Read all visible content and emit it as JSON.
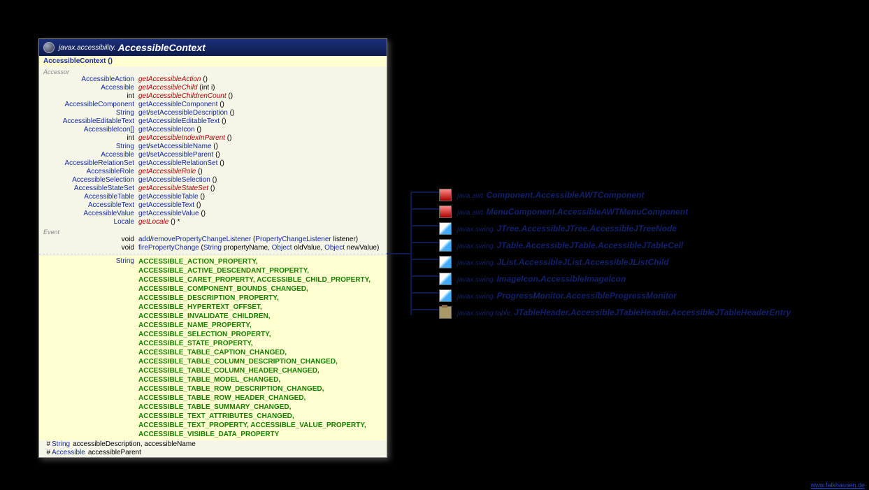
{
  "header": {
    "package": "javax.accessibility.",
    "class": "AccessibleContext"
  },
  "constructor": "AccessibleContext ()",
  "sections": {
    "accessor": "Accessor",
    "event": "Event"
  },
  "accessors": [
    {
      "ret": "AccessibleAction",
      "name": "getAccessibleAction",
      "params": "()",
      "abs": true
    },
    {
      "ret": "Accessible",
      "name": "getAccessibleChild",
      "params": "(int i)",
      "abs": true
    },
    {
      "ret": "int",
      "name": "getAccessibleChildrenCount",
      "params": "()",
      "abs": true,
      "retBlack": true
    },
    {
      "ret": "AccessibleComponent",
      "name": "getAccessibleComponent",
      "params": "()",
      "abs": false
    },
    {
      "ret": "String",
      "name": "get/setAccessibleDescription",
      "params": "()",
      "abs": false
    },
    {
      "ret": "AccessibleEditableText",
      "name": "getAccessibleEditableText",
      "params": "()",
      "abs": false
    },
    {
      "ret": "AccessibleIcon[]",
      "name": "getAccessibleIcon",
      "params": "()",
      "abs": false
    },
    {
      "ret": "int",
      "name": "getAccessibleIndexInParent",
      "params": "()",
      "abs": true,
      "retBlack": true
    },
    {
      "ret": "String",
      "name": "get/setAccessibleName",
      "params": "()",
      "abs": false
    },
    {
      "ret": "Accessible",
      "name": "get/setAccessibleParent",
      "params": "()",
      "abs": false
    },
    {
      "ret": "AccessibleRelationSet",
      "name": "getAccessibleRelationSet",
      "params": "()",
      "abs": false
    },
    {
      "ret": "AccessibleRole",
      "name": "getAccessibleRole",
      "params": "()",
      "abs": true
    },
    {
      "ret": "AccessibleSelection",
      "name": "getAccessibleSelection",
      "params": "()",
      "abs": false
    },
    {
      "ret": "AccessibleStateSet",
      "name": "getAccessibleStateSet",
      "params": "()",
      "abs": true
    },
    {
      "ret": "AccessibleTable",
      "name": "getAccessibleTable",
      "params": "()",
      "abs": false
    },
    {
      "ret": "AccessibleText",
      "name": "getAccessibleText",
      "params": "()",
      "abs": false
    },
    {
      "ret": "AccessibleValue",
      "name": "getAccessibleValue",
      "params": "()",
      "abs": false
    },
    {
      "ret": "Locale",
      "name": "getLocale",
      "params": "() *",
      "abs": true
    }
  ],
  "events": [
    {
      "ret": "void",
      "html": "<span class='nm-blue'>add</span>/<span class='nm-blue'>removePropertyChangeListener</span> (<span class='param-type'>PropertyChangeListener</span> listener)"
    },
    {
      "ret": "void",
      "html": "<span class='nm-blue'>firePropertyChange</span> (<span class='param-type'>String</span> propertyName, <span class='param-type'>Object</span> oldValue, <span class='param-type'>Object</span> newValue)"
    }
  ],
  "constants_type": "String",
  "constants": "ACCESSIBLE_ACTION_PROPERTY, ACCESSIBLE_ACTIVE_DESCENDANT_PROPERTY, ACCESSIBLE_CARET_PROPERTY, ACCESSIBLE_CHILD_PROPERTY, ACCESSIBLE_COMPONENT_BOUNDS_CHANGED, ACCESSIBLE_DESCRIPTION_PROPERTY, ACCESSIBLE_HYPERTEXT_OFFSET, ACCESSIBLE_INVALIDATE_CHILDREN, ACCESSIBLE_NAME_PROPERTY, ACCESSIBLE_SELECTION_PROPERTY, ACCESSIBLE_STATE_PROPERTY, ACCESSIBLE_TABLE_CAPTION_CHANGED, ACCESSIBLE_TABLE_COLUMN_DESCRIPTION_CHANGED, ACCESSIBLE_TABLE_COLUMN_HEADER_CHANGED, ACCESSIBLE_TABLE_MODEL_CHANGED, ACCESSIBLE_TABLE_ROW_DESCRIPTION_CHANGED, ACCESSIBLE_TABLE_ROW_HEADER_CHANGED, ACCESSIBLE_TABLE_SUMMARY_CHANGED, ACCESSIBLE_TEXT_ATTRIBUTES_CHANGED, ACCESSIBLE_TEXT_PROPERTY, ACCESSIBLE_VALUE_PROPERTY, ACCESSIBLE_VISIBLE_DATA_PROPERTY",
  "fields": [
    {
      "mod": "#",
      "type": "String",
      "names": "accessibleDescription, accessibleName"
    },
    {
      "mod": "#",
      "type": "Accessible",
      "names": "accessibleParent"
    }
  ],
  "implementors": [
    {
      "icon": "red",
      "pkg": "java.awt.",
      "cls": "Component.AccessibleAWTComponent"
    },
    {
      "icon": "red",
      "pkg": "java.awt.",
      "cls": "MenuComponent.AccessibleAWTMenuComponent"
    },
    {
      "icon": "blend",
      "pkg": "javax.swing.",
      "cls": "JTree.AccessibleJTree.AccessibleJTreeNode"
    },
    {
      "icon": "blend",
      "pkg": "javax.swing.",
      "cls": "JTable.AccessibleJTable.AccessibleJTableCell"
    },
    {
      "icon": "blend",
      "pkg": "javax.swing.",
      "cls": "JList.AccessibleJList.AccessibleJListChild"
    },
    {
      "icon": "blend",
      "pkg": "javax.swing.",
      "cls": "ImageIcon.AccessibleImageIcon"
    },
    {
      "icon": "blend",
      "pkg": "javax.swing.",
      "cls": "ProgressMonitor.AccessibleProgressMonitor"
    },
    {
      "icon": "brown",
      "pkg": "javax.swing.table.",
      "cls": "JTableHeader.AccessibleJTableHeader.AccessibleJTableHeaderEntry"
    }
  ],
  "footer": "www.falkhausen.de"
}
